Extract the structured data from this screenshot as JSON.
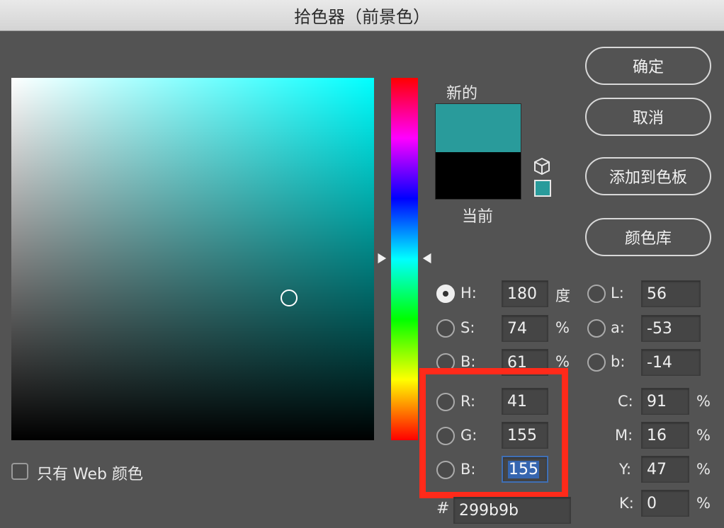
{
  "window": {
    "title": "拾色器（前景色）"
  },
  "preview": {
    "new_label": "新的",
    "current_label": "当前",
    "new_color": "#299b9b",
    "current_color": "#000000"
  },
  "buttons": {
    "ok": "确定",
    "cancel": "取消",
    "add_to_swatches": "添加到色板",
    "color_libraries": "颜色库"
  },
  "hsb": {
    "h": {
      "label": "H:",
      "value": "180",
      "unit": "度",
      "selected": true
    },
    "s": {
      "label": "S:",
      "value": "74",
      "unit": "%"
    },
    "b": {
      "label": "B:",
      "value": "61",
      "unit": "%"
    }
  },
  "lab": {
    "l": {
      "label": "L:",
      "value": "56"
    },
    "a": {
      "label": "a:",
      "value": "-53"
    },
    "b": {
      "label": "b:",
      "value": "-14"
    }
  },
  "rgb": {
    "r": {
      "label": "R:",
      "value": "41"
    },
    "g": {
      "label": "G:",
      "value": "155"
    },
    "b": {
      "label": "B:",
      "value": "155"
    }
  },
  "cmyk": {
    "c": {
      "label": "C:",
      "value": "91",
      "unit": "%"
    },
    "m": {
      "label": "M:",
      "value": "16",
      "unit": "%"
    },
    "y": {
      "label": "Y:",
      "value": "47",
      "unit": "%"
    },
    "k": {
      "label": "K:",
      "value": "0",
      "unit": "%"
    }
  },
  "hex": {
    "label": "#",
    "value": "299b9b"
  },
  "web_only": {
    "label": "只有 Web 颜色",
    "checked": false
  },
  "colors": {
    "highlight": "#ff2a1a",
    "hue_base": "#00ffff"
  },
  "icons": {
    "gamut_warning": "cube-icon",
    "web_safe": "web-swatch-icon"
  }
}
